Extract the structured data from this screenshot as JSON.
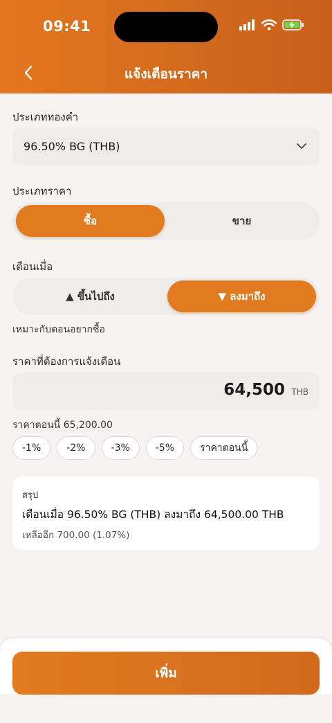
{
  "status_bar": {
    "time": "09:41"
  },
  "header": {
    "title": "แจ้งเตือนราคา"
  },
  "gold_type": {
    "label": "ประเภททองคำ",
    "selected": "96.50% BG (THB)"
  },
  "price_type": {
    "label": "ประเภทราคา",
    "options": [
      "ซื้อ",
      "ขาย"
    ],
    "selected": "ซื้อ"
  },
  "alert_when": {
    "label": "เตือนเมื่อ",
    "options": [
      "▲ ขึ้นไปถึง",
      "▼ ลงมาถึง"
    ],
    "selected": "▼ ลงมาถึง",
    "hint": "เหมาะกับตอนอยากซื้อ"
  },
  "target_price": {
    "label": "ราคาที่ต้องการแจ้งเตือน",
    "value": "64,500",
    "unit": "THB",
    "current_price": "ราคาตอนนี้ 65,200.00"
  },
  "chips": [
    "-1%",
    "-2%",
    "-3%",
    "-5%",
    "ราคาตอนนี้"
  ],
  "summary": {
    "title": "สรุป",
    "main": "เตือนเมื่อ 96.50% BG (THB) ลงมาถึง 64,500.00 THB",
    "remaining": "เหลืออีก 700.00 (1.07%)"
  },
  "add_button": {
    "label": "เพิ่ม"
  },
  "colors": {
    "accent": "#e27a20",
    "header": "#d46a1c",
    "background": "#f5f4f2"
  }
}
